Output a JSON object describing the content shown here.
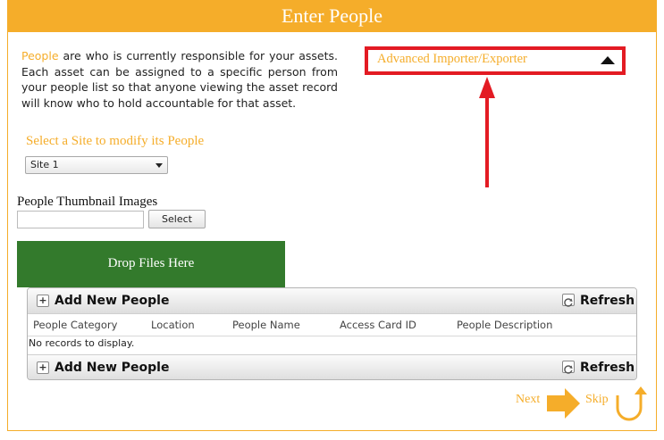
{
  "header": {
    "title": "Enter People"
  },
  "intro": {
    "keyword": "People",
    "text": " are who is currently responsible for your assets. Each asset can be assigned to a specific person from your people list so that anyone viewing the asset record will know who to hold accountable for that asset."
  },
  "site": {
    "label": "Select a Site to modify its People",
    "selected": "Site 1"
  },
  "advanced": {
    "label": "Advanced Importer/Exporter"
  },
  "thumbnails": {
    "label": "People Thumbnail Images",
    "select_label": "Select",
    "drop_label": "Drop Files Here"
  },
  "grid": {
    "add_label": "Add New People",
    "refresh_label": "Refresh",
    "columns": [
      "People Category",
      "Location",
      "People Name",
      "Access Card ID",
      "People Description"
    ],
    "empty_text": "No records to display."
  },
  "nav": {
    "next": "Next",
    "skip": "Skip"
  },
  "colors": {
    "accent": "#f5ad2a",
    "highlight": "#e31b23",
    "dropzone": "#337a2c"
  }
}
